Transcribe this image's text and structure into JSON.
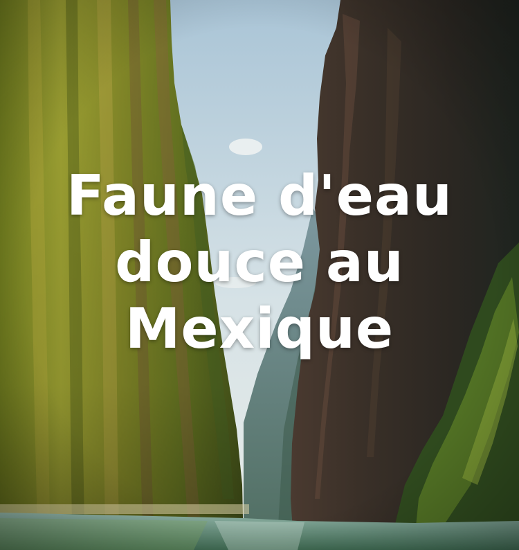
{
  "title_lines": [
    "Faune d'eau",
    "douce au",
    "Mexique"
  ],
  "colors": {
    "title_text": "#ffffff",
    "sky_top": "#a9c4d6",
    "sky_bottom": "#e6ece9",
    "left_cliff_sunlit": "#9aa52e",
    "left_cliff_shadow": "#4d5a1e",
    "right_cliff_dark": "#27241f",
    "distant_ridge": "#6f8c94",
    "river_water": "#5f8a74"
  }
}
